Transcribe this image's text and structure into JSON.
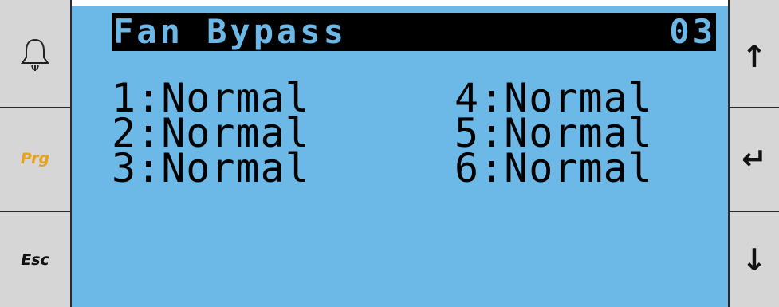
{
  "left_buttons": {
    "alarm_icon": "bell-icon",
    "prg_label": "Prg",
    "esc_label": "Esc"
  },
  "right_buttons": {
    "up_icon": "arrow-up-icon",
    "up_glyph": "↑",
    "enter_icon": "enter-icon",
    "enter_glyph": "↵",
    "down_icon": "arrow-down-icon",
    "down_glyph": "↓"
  },
  "screen": {
    "title": "Fan Bypass",
    "page_number": "03",
    "fans_left": [
      {
        "label": "1:Normal"
      },
      {
        "label": "2:Normal"
      },
      {
        "label": "3:Normal"
      }
    ],
    "fans_right": [
      {
        "label": "4:Normal"
      },
      {
        "label": "5:Normal"
      },
      {
        "label": "6:Normal"
      }
    ],
    "colors": {
      "lcd_background": "#6cb8e6",
      "text": "#000000",
      "prg_accent": "#e6a21a"
    }
  }
}
